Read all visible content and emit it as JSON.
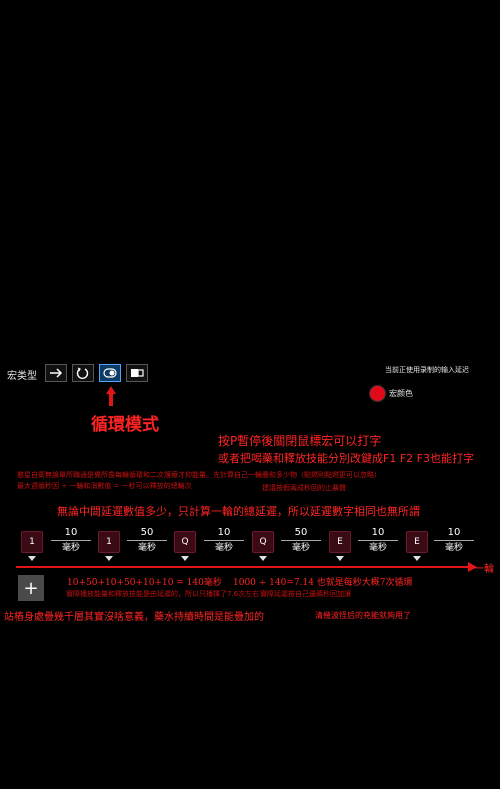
{
  "top_label": "宏类型",
  "right_label": "当前正使用录制的输入延迟",
  "color_label": "宏颜色",
  "accent_color": "#e00a1a",
  "annotation_mode": "循環模式",
  "annotation_line1": "按P暫停後關閉鼠標宏可以打字",
  "annotation_line2": "或者把喝藥和釋放技能分別改鍵成F1 F2 F3也能打字",
  "tiny_line1": "憨星自衛無論單所職通是覺所擔每輪循環和二次護療才抑能量。先計算自己一輪疊和多少物（點燃則點燃更可以忽略）",
  "tiny_line2a": "最大週循秒因 ÷ 一輪和消數值 = 一秒可以釋放的總輪次",
  "tiny_line2b": "建議按假兩成秒回的止暴聲",
  "big_red_line": "無論中間延遲數值多少，只計算一輪的總延遲，所以延遲數字相同也無所謂",
  "steps": [
    {
      "key": "1",
      "delay": "10",
      "unit": "毫秒"
    },
    {
      "key": "1",
      "delay": "50",
      "unit": "毫秒"
    },
    {
      "key": "Q",
      "delay": "10",
      "unit": "毫秒"
    },
    {
      "key": "Q",
      "delay": "50",
      "unit": "毫秒"
    },
    {
      "key": "E",
      "delay": "10",
      "unit": "毫秒"
    },
    {
      "key": "E",
      "delay": "10",
      "unit": "毫秒"
    }
  ],
  "arrow_label": "一輪",
  "calc_line_a": "10+50+10+50+10+10 = 140毫秒",
  "calc_line_b": "1000 ÷ 140=7.14 也就是每秒大概7次循環",
  "calc_small_a": "實際播放能量和釋放技能是由延遲的，所以只播揮了7.6次左右",
  "calc_small_b": "實際延遲按自己邊碼秒回加讓",
  "bottom_line": "站樁身處疊幾千層其實沒啥意義，藥水持續時間是能疊加的",
  "bottom_line_tail": "清幾波怪后的充能就夠用了",
  "add_button": "+"
}
